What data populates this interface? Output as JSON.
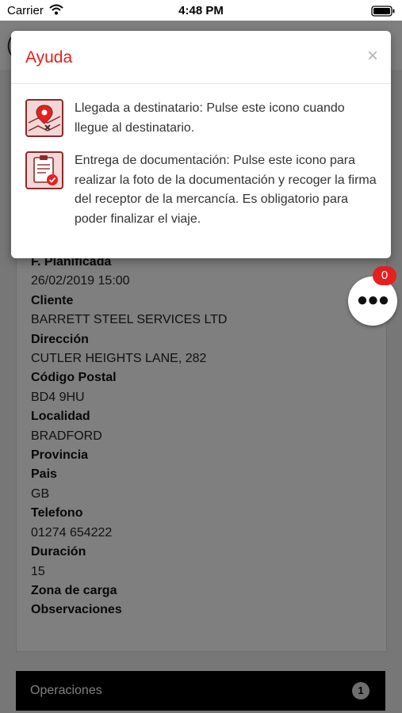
{
  "status_bar": {
    "carrier": "Carrier",
    "time": "4:48 PM"
  },
  "trip": {
    "fields": [
      {
        "label": "F. Planificada",
        "value": "26/02/2019 15:00"
      },
      {
        "label": "Cliente",
        "value": "BARRETT STEEL SERVICES LTD"
      },
      {
        "label": "Dirección",
        "value": "CUTLER HEIGHTS LANE, 282"
      },
      {
        "label": "Código Postal",
        "value": "BD4 9HU"
      },
      {
        "label": "Localidad",
        "value": "BRADFORD"
      },
      {
        "label": "Provincia",
        "value": ""
      },
      {
        "label": "Pais",
        "value": "GB"
      },
      {
        "label": "Telefono",
        "value": "01274 654222"
      },
      {
        "label": "Duración",
        "value": "15"
      },
      {
        "label": "Zona de carga",
        "value": ""
      },
      {
        "label": "Observaciones",
        "value": ""
      }
    ],
    "operations": {
      "label": "Operaciones",
      "count": "1"
    }
  },
  "fab": {
    "badge_count": "0"
  },
  "help_modal": {
    "title": "Ayuda",
    "close_symbol": "×",
    "items": [
      {
        "icon": "map-pin-destination-icon",
        "text": "Llegada a destinatario: Pulse este icono cuando llegue al destinatario."
      },
      {
        "icon": "clipboard-check-icon",
        "text": "Entrega de documentación: Pulse este icono para realizar la foto de la documentación y recoger la firma del receptor de la mercancía. Es obligatorio para poder finalizar el viaje."
      }
    ]
  },
  "colors": {
    "accent": "#e5201f",
    "icon_dark": "#8c2a2a",
    "icon_fill": "#f3d7d7"
  }
}
